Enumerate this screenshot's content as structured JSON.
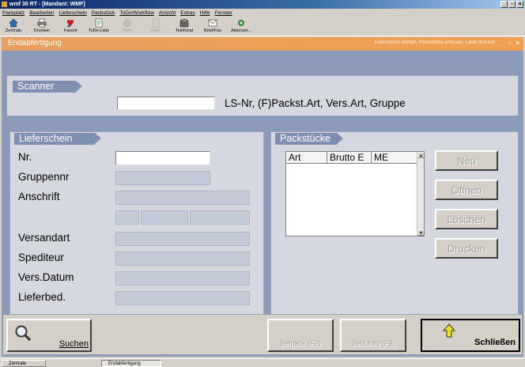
{
  "window": {
    "title": "wmf 30 RT - [Mandant: WMF]",
    "controls": [
      "_",
      "▫",
      "×"
    ]
  },
  "menu": [
    "Packplatz",
    "Bearbeiten",
    "Lieferschein",
    "Packstück",
    "ToDo/Workflow",
    "Ansicht",
    "Extras",
    "Hilfe",
    "Fenster"
  ],
  "toolbar": [
    {
      "label": "Zentrale",
      "icon": "home-icon",
      "enabled": true
    },
    {
      "label": "Drucken",
      "icon": "printer-icon",
      "enabled": true
    },
    {
      "label": "Favorit",
      "icon": "favorite-icon",
      "enabled": true
    },
    {
      "label": "ToDo-Liste",
      "icon": "todo-list-icon",
      "enabled": true
    },
    {
      "label": "ToDo",
      "icon": "todo-icon",
      "enabled": false
    },
    {
      "label": "Notiz",
      "icon": "note-icon",
      "enabled": false
    },
    {
      "label": "Telefonat",
      "icon": "phone-icon",
      "enabled": true
    },
    {
      "label": "Brief/Fax",
      "icon": "fax-icon",
      "enabled": true
    },
    {
      "label": "Aktenver...",
      "icon": "files-icon",
      "enabled": true
    }
  ],
  "doc": {
    "title": "Endabfertigung",
    "hint": "Lieferschein wählen, Packstücke erfassen, Label drucken.",
    "controls": "_ ▫ ×"
  },
  "scanner": {
    "tab": "Scanner",
    "small_label": "▯ ▮▮",
    "value": "",
    "help": "LS-Nr, (F)Packst.Art, Vers.Art, Gruppe"
  },
  "lieferschein": {
    "tab": "Lieferschein",
    "labels": {
      "nr": "Nr.",
      "gruppennr": "Gruppennr",
      "anschrift": "Anschrift",
      "versandart": "Versandart",
      "spediteur": "Spediteur",
      "versdatum": "Vers.Datum",
      "lieferbed": "Lieferbed."
    },
    "values": {
      "nr": "",
      "gruppennr": "",
      "anschrift": "",
      "plz": "",
      "ort": "",
      "land": "",
      "versandart": "",
      "spediteur": "",
      "versdatum": "",
      "lieferbed": ""
    }
  },
  "packstuecke": {
    "tab": "Packstücke",
    "columns": [
      "Art",
      "Brutto E",
      "ME"
    ],
    "rows": [],
    "buttons": {
      "neu": "Neu",
      "oeffnen": "Öffnen",
      "loeschen": "Löschen",
      "drucken": "Drucken"
    }
  },
  "bottom": {
    "suchen": "Suchen",
    "beipack": "Beipack (F2)",
    "versinfo": "Vers.Info (F9)",
    "schliessen": "Schließen"
  },
  "taskbar": [
    {
      "label": "Zentrale",
      "active": false
    },
    {
      "label": "Endabfertigung",
      "active": true
    }
  ]
}
